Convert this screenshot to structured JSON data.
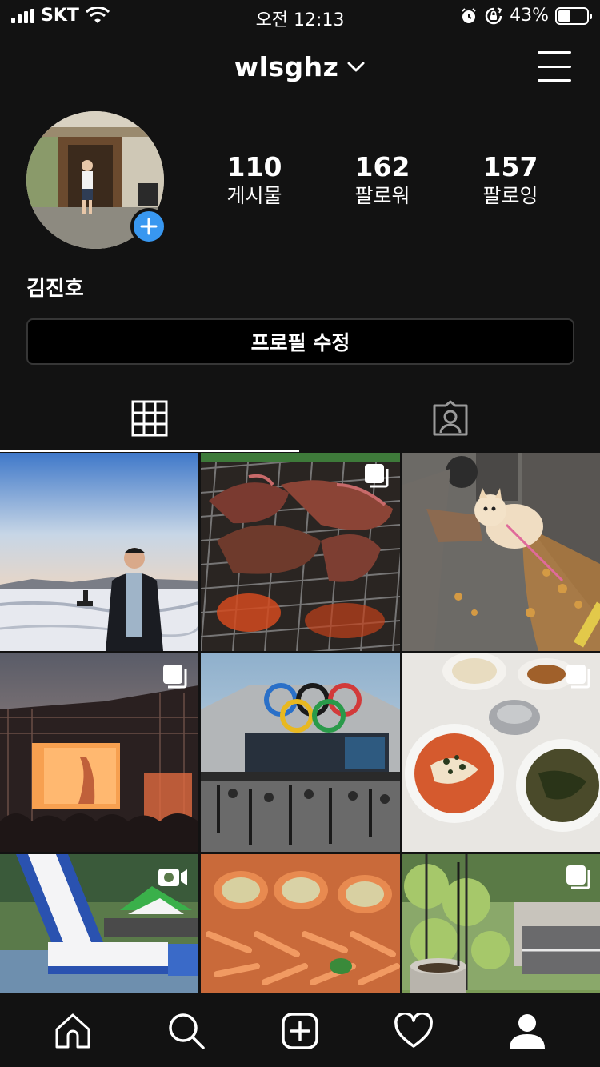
{
  "status_bar": {
    "carrier": "SKT",
    "time": "오전 12:13",
    "battery": "43%",
    "battery_level": 0.43
  },
  "header": {
    "username": "wlsghz",
    "dropdown_icon": "chevron-down-icon",
    "menu_icon": "hamburger-menu-icon"
  },
  "profile": {
    "display_name": "김진호",
    "stats": [
      {
        "value": "110",
        "label": "게시물"
      },
      {
        "value": "162",
        "label": "팔로워"
      },
      {
        "value": "157",
        "label": "팔로잉"
      }
    ],
    "edit_button": "프로필 수정"
  },
  "tabs": [
    {
      "icon": "grid-icon",
      "active": true
    },
    {
      "icon": "tagged-person-icon",
      "active": false
    }
  ],
  "grid": [
    {
      "subject": "photo",
      "badge": null
    },
    {
      "subject": "photo",
      "badge": "multiple-photos-icon"
    },
    {
      "subject": "photo",
      "badge": null
    },
    {
      "subject": "photo",
      "badge": "multiple-photos-icon"
    },
    {
      "subject": "photo",
      "badge": null
    },
    {
      "subject": "photo",
      "badge": "multiple-photos-icon"
    },
    {
      "subject": "photo",
      "badge": "video-icon"
    },
    {
      "subject": "photo",
      "badge": null
    },
    {
      "subject": "photo",
      "badge": "multiple-photos-icon"
    }
  ],
  "bottom_nav": [
    "home-icon",
    "search-icon",
    "new-post-icon",
    "activity-heart-icon",
    "profile-icon"
  ],
  "colors": {
    "background": "#121212",
    "accent": "#3897f0",
    "border": "#363636"
  }
}
